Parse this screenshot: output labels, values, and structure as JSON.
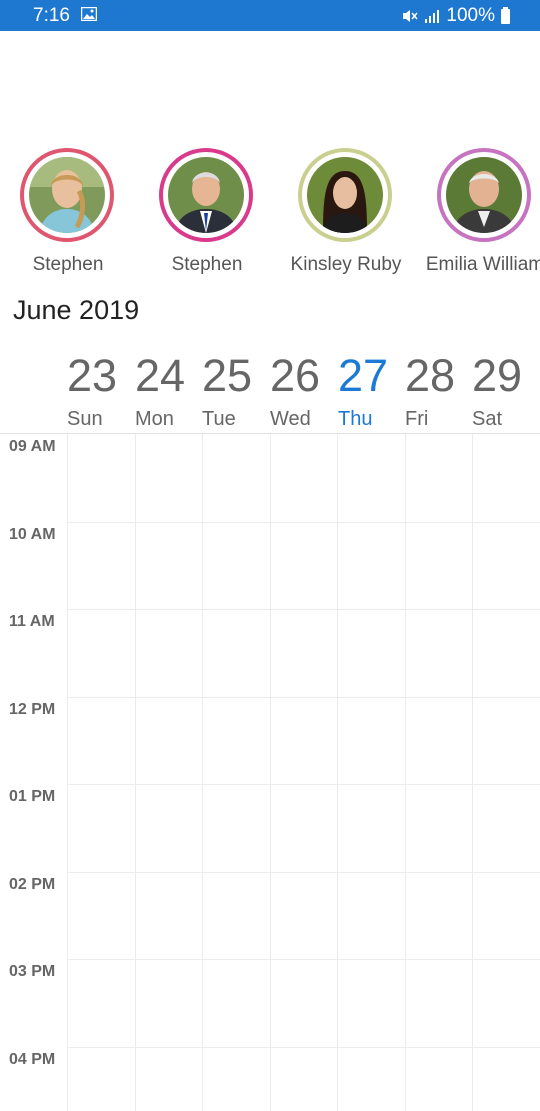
{
  "status_bar": {
    "time": "7:16",
    "battery": "100%",
    "icons": [
      "image-icon",
      "mute-icon",
      "signal-icon",
      "battery-icon"
    ]
  },
  "resources": [
    {
      "name": "Stephen",
      "ring_color": "#e0566f"
    },
    {
      "name": "Stephen",
      "ring_color": "#d93a8c"
    },
    {
      "name": "Kinsley Ruby",
      "ring_color": "#c9cf8e"
    },
    {
      "name": "Emilia William",
      "ring_color": "#c774c0"
    }
  ],
  "calendar": {
    "month_year": "June 2019",
    "days": [
      {
        "num": "23",
        "name": "Sun"
      },
      {
        "num": "24",
        "name": "Mon"
      },
      {
        "num": "25",
        "name": "Tue"
      },
      {
        "num": "26",
        "name": "Wed"
      },
      {
        "num": "27",
        "name": "Thu",
        "today": true
      },
      {
        "num": "28",
        "name": "Fri"
      },
      {
        "num": "29",
        "name": "Sat"
      }
    ],
    "time_slots": [
      "09 AM",
      "10 AM",
      "11 AM",
      "12 PM",
      "01 PM",
      "02 PM",
      "03 PM",
      "04 PM"
    ],
    "today_color": "#1c7ad4"
  }
}
